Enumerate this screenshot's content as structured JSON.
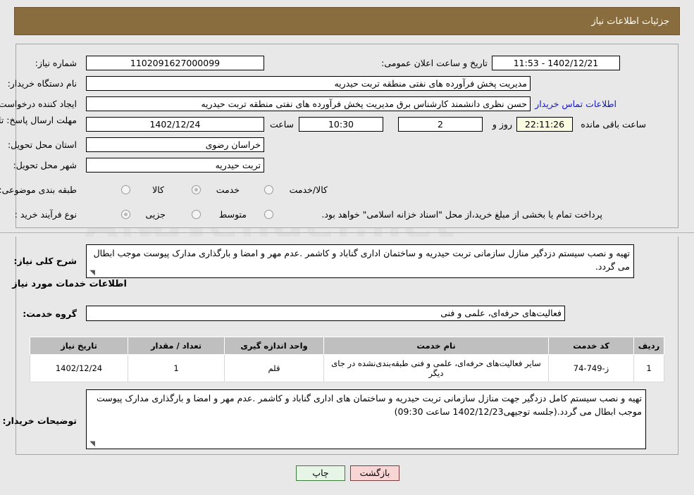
{
  "header": {
    "title": "جزئیات اطلاعات نیاز",
    "bg": "#8a6d3f"
  },
  "form": {
    "need_number_label": "شماره نیاز:",
    "need_number_value": "1102091627000099",
    "announce_label": "تاریخ و ساعت اعلان عمومی:",
    "announce_value": "1402/12/21 - 11:53",
    "buyer_org_label": "نام دستگاه خریدار:",
    "buyer_org_value": "مدیریت پخش فرآورده های نفتی منطقه تربت حیدریه",
    "creator_label": "ایجاد کننده درخواست:",
    "creator_value": "حسن نظری دانشمند کارشناس برق مدیریت پخش فرآورده های نفتی منطقه تربت حیدریه",
    "contact_link": "اطلاعات تماس خریدار",
    "deadline_label": "مهلت ارسال پاسخ: تا تاریخ:",
    "deadline_date": "1402/12/24",
    "hour_label": "ساعت",
    "deadline_time": "10:30",
    "days_value": "2",
    "days_label": "روز و",
    "countdown_value": "22:11:26",
    "remaining_label": "ساعت باقی مانده",
    "province_label": "استان محل تحویل:",
    "province_value": "خراسان رضوی",
    "city_label": "شهر محل تحویل:",
    "city_value": "تربت حیدریه",
    "category_label": "طبقه بندی موضوعی:",
    "category_options": [
      "کالا",
      "خدمت",
      "کالا/خدمت"
    ],
    "category_selected": "خدمت",
    "process_label": "نوع فرآیند خرید :",
    "process_options": [
      "جزیی",
      "متوسط",
      "پرداخت تمام یا"
    ],
    "process_selected": "جزیی",
    "payment_note": "پرداخت تمام یا بخشی از مبلغ خرید،از محل \"اسناد خزانه اسلامی\" خواهد بود."
  },
  "description": {
    "label": "شرح کلی نیاز:",
    "value": "تهیه و نصب سیستم دزدگیر منازل سازمانی تربت حیدریه و ساختمان اداری گناباد و کاشمر .عدم مهر و امضا و بارگذاری مدارک پیوست موجب ابطال می گردد."
  },
  "services_section": {
    "title": "اطلاعات خدمات مورد نیاز",
    "group_label": "گروه خدمت:",
    "group_value": "فعالیت‌های حرفه‌ای، علمی و فنی"
  },
  "table": {
    "headers": [
      "ردیف",
      "کد خدمت",
      "نام خدمت",
      "واحد اندازه گیری",
      "تعداد / مقدار",
      "تاریخ نیاز"
    ],
    "rows": [
      {
        "row": "1",
        "code": "ز-749-74",
        "name": "سایر فعالیت‌های حرفه‌ای، علمی و فنی طبقه‌بندی‌نشده در جای دیگر",
        "unit": "قلم",
        "qty": "1",
        "date": "1402/12/24"
      }
    ]
  },
  "buyer_notes": {
    "label": "توضیحات خریدار:",
    "value": "تهیه و نصب سیستم کامل دزدگیر جهت منازل سازمانی تربت حیدریه و ساختمان های اداری گناباد و کاشمر .عدم مهر و امضا و بارگذاری مدارک پیوست موجب ابطال می گردد.(جلسه توجیهی1402/12/23 ساعت 09:30)"
  },
  "buttons": {
    "print": "چاپ",
    "back": "بازگشت"
  },
  "watermark": {
    "text": "AnaTender.net"
  }
}
